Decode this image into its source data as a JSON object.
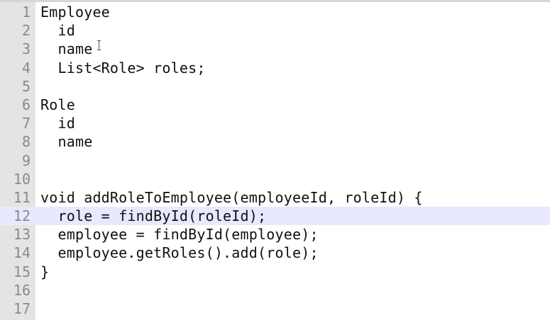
{
  "editor": {
    "current_line": 12,
    "lines": [
      {
        "num": "1",
        "text": "Employee"
      },
      {
        "num": "2",
        "text": "  id"
      },
      {
        "num": "3",
        "text": "  name"
      },
      {
        "num": "4",
        "text": "  List<Role> roles;"
      },
      {
        "num": "5",
        "text": ""
      },
      {
        "num": "6",
        "text": "Role"
      },
      {
        "num": "7",
        "text": "  id"
      },
      {
        "num": "8",
        "text": "  name"
      },
      {
        "num": "9",
        "text": ""
      },
      {
        "num": "10",
        "text": ""
      },
      {
        "num": "11",
        "text": "void addRoleToEmployee(employeeId, roleId) {"
      },
      {
        "num": "12",
        "text": "  role = findById(roleId);"
      },
      {
        "num": "13",
        "text": "  employee = findById(employee);"
      },
      {
        "num": "14",
        "text": "  employee.getRoles().add(role);"
      },
      {
        "num": "15",
        "text": "}"
      },
      {
        "num": "16",
        "text": ""
      },
      {
        "num": "17",
        "text": ""
      }
    ]
  }
}
